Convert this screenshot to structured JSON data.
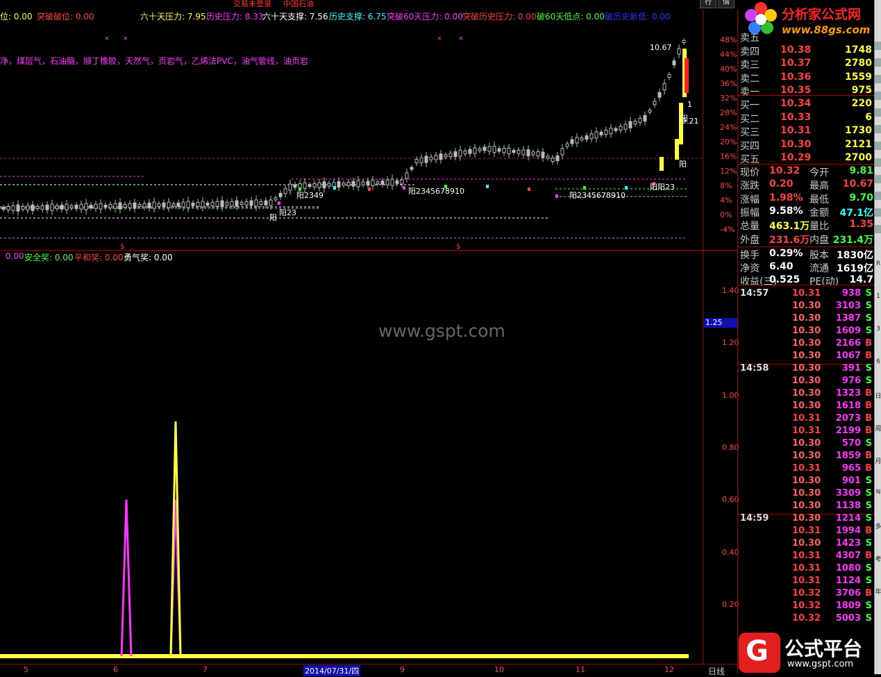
{
  "window": {
    "title_left": "交易未登录",
    "title_stock": "中国石油",
    "btn1": "行",
    "btn2": "情"
  },
  "indicators_top": [
    {
      "text": "位: 0.00",
      "color": "#ffff40"
    },
    {
      "text": "突破破位: 0.00",
      "color": "#ff4040"
    },
    {
      "text": "六十天压力: 7.95",
      "color": "#ffff40"
    },
    {
      "text": "历史压力: 8.33",
      "color": "#ff33ff"
    },
    {
      "text": "六十天支撑: 7.56",
      "color": "#ffffff"
    },
    {
      "text": "历史支撑: 6.75",
      "color": "#33ffff"
    },
    {
      "text": "突破60天压力: 0.00",
      "color": "#ff33ff"
    },
    {
      "text": "突破历史压力: 0.00",
      "color": "#ff4040"
    },
    {
      "text": "破60天低点: 0.00",
      "color": "#40ff40"
    },
    {
      "text": "破历史新低: 0.00",
      "color": "#3030ff"
    }
  ],
  "sectors": "净，煤层气，石油脑，顺丁橡胶，天然气，页岩气，乙烯法PVC，油气管线，油页岩",
  "indicators_low": [
    {
      "text": "0.00",
      "color": "#ff33ff"
    },
    {
      "text": "安全奖: 0.00",
      "color": "#40ff40"
    },
    {
      "text": "平和奖: 0.00",
      "color": "#ff4040"
    },
    {
      "text": "勇气奖: 0.00",
      "color": "#ffffff"
    }
  ],
  "watermark": "www.gspt.com",
  "chart_annotations": {
    "high_label": "10.67",
    "last_label": "9.21",
    "yang_labels": [
      "阳",
      "阳2349",
      "阳2345678910",
      "阳2345678910",
      "阳阳23",
      "阳",
      "阳23",
      "阳"
    ],
    "marker_1": "1"
  },
  "axis_pct": [
    "48%",
    "44%",
    "40%",
    "36%",
    "32%",
    "28%",
    "24%",
    "20%",
    "16%",
    "12%",
    "8%",
    "4%",
    "0%",
    "-4%"
  ],
  "axis_low": [
    "1.40",
    "1.20",
    "1.00",
    "0.80",
    "0.60",
    "0.40",
    "0.20"
  ],
  "axis_low_current": "1.25",
  "xaxis": {
    "labels": [
      "5",
      "6",
      "7",
      "9",
      "10",
      "11",
      "12"
    ],
    "date": "2014/07/31/四",
    "period_button": "日线"
  },
  "chart_data": {
    "type": "line",
    "title": "",
    "x": [
      5,
      6,
      7,
      8,
      9,
      10,
      11,
      12
    ],
    "series": [
      {
        "name": "",
        "color": "#ff33ff",
        "values": [
          0,
          0.6,
          0,
          0.6,
          0,
          0,
          0,
          0
        ]
      },
      {
        "name": "",
        "color": "#ffff40",
        "values": [
          0,
          0,
          0,
          0.9,
          0,
          0,
          0,
          0
        ]
      }
    ],
    "ylim": [
      0,
      1.5
    ],
    "grid": false
  },
  "order_book": {
    "asks": [
      {
        "label": "卖五",
        "price": "",
        "vol": ""
      },
      {
        "label": "卖四",
        "price": "10.38",
        "vol": "1748"
      },
      {
        "label": "卖三",
        "price": "10.37",
        "vol": "2780"
      },
      {
        "label": "卖二",
        "price": "10.36",
        "vol": "1559"
      },
      {
        "label": "卖一",
        "price": "10.35",
        "vol": "975"
      }
    ],
    "bids": [
      {
        "label": "买一",
        "price": "10.34",
        "vol": "220"
      },
      {
        "label": "买二",
        "price": "10.33",
        "vol": "6"
      },
      {
        "label": "买三",
        "price": "10.31",
        "vol": "1730"
      },
      {
        "label": "买四",
        "price": "10.30",
        "vol": "2121"
      },
      {
        "label": "买五",
        "price": "10.29",
        "vol": "2700"
      }
    ]
  },
  "quote": [
    {
      "l1": "现价",
      "v1": "10.32",
      "c1": "#ff4040",
      "l2": "今开",
      "v2": "9.81",
      "c2": "#40ff40"
    },
    {
      "l1": "涨跌",
      "v1": "0.20",
      "c1": "#ff4040",
      "l2": "最高",
      "v2": "10.67",
      "c2": "#ff4040"
    },
    {
      "l1": "涨幅",
      "v1": "1.98%",
      "c1": "#ff4040",
      "l2": "最低",
      "v2": "9.70",
      "c2": "#40ff40"
    },
    {
      "l1": "振幅",
      "v1": "9.58%",
      "c1": "#ffffff",
      "l2": "金额",
      "v2": "47.1亿",
      "c2": "#33ffff"
    },
    {
      "l1": "总量",
      "v1": "463.1万",
      "c1": "#ffff40",
      "l2": "量比",
      "v2": "1.35",
      "c2": "#ff4040"
    },
    {
      "l1": "外盘",
      "v1": "231.6万",
      "c1": "#ff4040",
      "l2": "内盘",
      "v2": "231.4万",
      "c2": "#40ff40"
    },
    {
      "l1": "换手",
      "v1": "0.29%",
      "c1": "#ffffff",
      "l2": "股本",
      "v2": "1830亿",
      "c2": "#ffffff"
    },
    {
      "l1": "净资",
      "v1": "6.40",
      "c1": "#ffffff",
      "l2": "流通",
      "v2": "1619亿",
      "c2": "#ffffff"
    },
    {
      "l1": "收益(三)",
      "v1": "0.525",
      "c1": "#ffffff",
      "l2": "PE(动)",
      "v2": "14.7",
      "c2": "#ffffff"
    }
  ],
  "ticks": [
    {
      "time": "14:57",
      "price": "10.31",
      "vol": "938",
      "dir": "S"
    },
    {
      "time": "",
      "price": "10.30",
      "vol": "3103",
      "dir": "S"
    },
    {
      "time": "",
      "price": "10.30",
      "vol": "1387",
      "dir": "S"
    },
    {
      "time": "",
      "price": "10.30",
      "vol": "1609",
      "dir": "S"
    },
    {
      "time": "",
      "price": "10.30",
      "vol": "2166",
      "dir": "B"
    },
    {
      "time": "",
      "price": "10.30",
      "vol": "1067",
      "dir": "B"
    },
    {
      "time": "14:58",
      "price": "10.30",
      "vol": "391",
      "dir": "S"
    },
    {
      "time": "",
      "price": "10.30",
      "vol": "976",
      "dir": "S"
    },
    {
      "time": "",
      "price": "10.30",
      "vol": "1323",
      "dir": "B"
    },
    {
      "time": "",
      "price": "10.30",
      "vol": "1618",
      "dir": "B"
    },
    {
      "time": "",
      "price": "10.31",
      "vol": "2073",
      "dir": "B"
    },
    {
      "time": "",
      "price": "10.31",
      "vol": "2199",
      "dir": "B"
    },
    {
      "time": "",
      "price": "10.30",
      "vol": "570",
      "dir": "S"
    },
    {
      "time": "",
      "price": "10.30",
      "vol": "1859",
      "dir": "B"
    },
    {
      "time": "",
      "price": "10.31",
      "vol": "965",
      "dir": "B"
    },
    {
      "time": "",
      "price": "10.30",
      "vol": "901",
      "dir": "S"
    },
    {
      "time": "",
      "price": "10.30",
      "vol": "3309",
      "dir": "S"
    },
    {
      "time": "",
      "price": "10.30",
      "vol": "1138",
      "dir": "S"
    },
    {
      "time": "14:59",
      "price": "10.30",
      "vol": "1214",
      "dir": "S"
    },
    {
      "time": "",
      "price": "10.31",
      "vol": "1994",
      "dir": "B"
    },
    {
      "time": "",
      "price": "10.30",
      "vol": "1423",
      "dir": "S"
    },
    {
      "time": "",
      "price": "10.31",
      "vol": "4307",
      "dir": "B"
    },
    {
      "time": "",
      "price": "10.31",
      "vol": "1080",
      "dir": "S"
    },
    {
      "time": "",
      "price": "10.31",
      "vol": "1124",
      "dir": "S"
    },
    {
      "time": "",
      "price": "10.32",
      "vol": "3706",
      "dir": "B"
    },
    {
      "time": "",
      "price": "10.32",
      "vol": "1809",
      "dir": "S"
    },
    {
      "time": "",
      "price": "10.32",
      "vol": "5003",
      "dir": "S"
    }
  ],
  "logo_top": {
    "name": "分析家公式网",
    "url": "www.88gs.com"
  },
  "logo_bottom": {
    "glyph": "G",
    "name": "公式平台",
    "url": "www.gspt.com"
  },
  "sidebar_labels": [
    "R",
    "1",
    "3",
    "6",
    "日",
    "周",
    "月",
    "N",
    "多",
    "考",
    "年"
  ]
}
